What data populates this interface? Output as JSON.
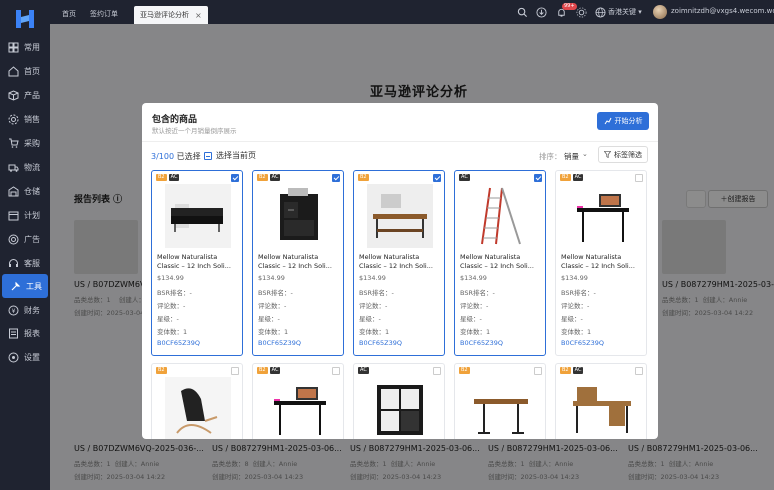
{
  "topbar": {
    "tabs": [
      {
        "label": "首页"
      },
      {
        "label": "签约订单"
      },
      {
        "label": "亚马逊评论分析",
        "close": "×"
      }
    ],
    "notification_count": "99+",
    "region": "香港关键",
    "account": "zoimnitzdh@vxgs4.wecom.work"
  },
  "sidebar": {
    "items": [
      {
        "label": "常用",
        "icon": "grid-icon"
      },
      {
        "label": "首页",
        "icon": "home-icon"
      },
      {
        "label": "产品",
        "icon": "box-icon"
      },
      {
        "label": "销售",
        "icon": "gear-icon"
      },
      {
        "label": "采购",
        "icon": "cart-icon"
      },
      {
        "label": "物流",
        "icon": "truck-icon"
      },
      {
        "label": "仓储",
        "icon": "warehouse-icon"
      },
      {
        "label": "计划",
        "icon": "calendar-icon"
      },
      {
        "label": "广告",
        "icon": "target-icon"
      },
      {
        "label": "客服",
        "icon": "headset-icon"
      },
      {
        "label": "工具",
        "icon": "tool-icon"
      },
      {
        "label": "财务",
        "icon": "money-icon"
      },
      {
        "label": "报表",
        "icon": "report-icon"
      },
      {
        "label": "设置",
        "icon": "settings-icon"
      }
    ],
    "active_index": 10
  },
  "page": {
    "title": "亚马逊评论分析",
    "report_list_label": "报告列表",
    "create_report": "创建报告",
    "bg_cards_top": [
      {
        "name": "US / B07DZWM6V...",
        "count": "品类总数：1",
        "creator": "创建人：Annie",
        "time": "创建时间：2025-03-04 14:22"
      },
      {
        "name": "US / B087279HM1-2025-03-06...",
        "count": "品类总数：1",
        "creator": "创建人：Annie",
        "time": "创建时间：2025-03-04 14:22"
      }
    ],
    "bg_cards_bottom": [
      {
        "name": "US / B07DZWM6VQ-2025-036-...",
        "count": "品类总数：1",
        "creator": "创建人：Annie",
        "time": "创建时间：2025-03-04 14:22"
      },
      {
        "name": "US / B087279HM1-2025-03-06...",
        "count": "品类总数：8",
        "creator": "创建人：Annie",
        "time": "创建时间：2025-03-04 14:23"
      },
      {
        "name": "US / B087279HM1-2025-03-06...",
        "count": "品类总数：1",
        "creator": "创建人：Annie",
        "time": "创建时间：2025-03-04 14:23"
      },
      {
        "name": "US / B087279HM1-2025-03-06...",
        "count": "品类总数：1",
        "creator": "创建人：Annie",
        "time": "创建时间：2025-03-04 14:23"
      },
      {
        "name": "US / B087279HM1-2025-03-06...",
        "count": "品类总数：1",
        "creator": "创建人：Annie",
        "time": "创建时间：2025-03-04 14:23"
      }
    ]
  },
  "modal": {
    "title": "包含的商品",
    "subtitle": "默认按近一个月销量倒序展示",
    "start_button": "开始分析",
    "selected_num": "3/100",
    "selected_label": "已选择",
    "select_page": "选择当前页",
    "sort_label": "排序：",
    "sort_value": "销量",
    "tag_filter": "标签筛选",
    "products": [
      {
        "tags": [
          "B2",
          "AC"
        ],
        "selected": true,
        "image": "sofa",
        "title1": "Mellow Naturalista",
        "title2": "Classic – 12 Inch Soli...",
        "price": "$134.99",
        "bsr": "BSR排名：-",
        "reviews": "评论数：-",
        "stars": "星级：-",
        "variants": "变体数：1",
        "asin": "B0CF65Z39Q"
      },
      {
        "tags": [
          "B2",
          "AC"
        ],
        "selected": true,
        "image": "cabinet",
        "title1": "Mellow Naturalista",
        "title2": "Classic – 12 Inch Soli...",
        "price": "$134.99",
        "bsr": "BSR排名：-",
        "reviews": "评论数：-",
        "stars": "星级：-",
        "variants": "变体数：1",
        "asin": "B0CF65Z39Q"
      },
      {
        "tags": [
          "B2"
        ],
        "selected": true,
        "image": "coffee-table",
        "title1": "Mellow Naturalista",
        "title2": "Classic – 12 Inch Soli...",
        "price": "$134.99",
        "bsr": "BSR排名：-",
        "reviews": "评论数：-",
        "stars": "星级：-",
        "variants": "变体数：1",
        "asin": "B0CF65Z39Q"
      },
      {
        "tags": [
          "AC"
        ],
        "selected": true,
        "image": "ladder",
        "title1": "Mellow Naturalista",
        "title2": "Classic – 12 Inch Soli...",
        "price": "$134.99",
        "bsr": "BSR排名：-",
        "reviews": "评论数：-",
        "stars": "星级：-",
        "variants": "变体数：1",
        "asin": "B0CF65Z39Q"
      },
      {
        "tags": [
          "B2",
          "AC"
        ],
        "selected": false,
        "image": "desk",
        "title1": "Mellow Naturalista",
        "title2": "Classic – 12 Inch Soli...",
        "price": "$134.99",
        "bsr": "BSR排名：-",
        "reviews": "评论数：-",
        "stars": "星级：-",
        "variants": "变体数：1",
        "asin": "B0CF65Z39Q"
      }
    ],
    "products_row2": [
      {
        "tags": [
          "B2"
        ],
        "image": "chair"
      },
      {
        "tags": [
          "B2",
          "AC"
        ],
        "image": "desk"
      },
      {
        "tags": [
          "AC"
        ],
        "image": "shelf"
      },
      {
        "tags": [
          "B2"
        ],
        "image": "standing-desk"
      },
      {
        "tags": [
          "B2",
          "AC"
        ],
        "image": "wood-desk"
      }
    ]
  }
}
